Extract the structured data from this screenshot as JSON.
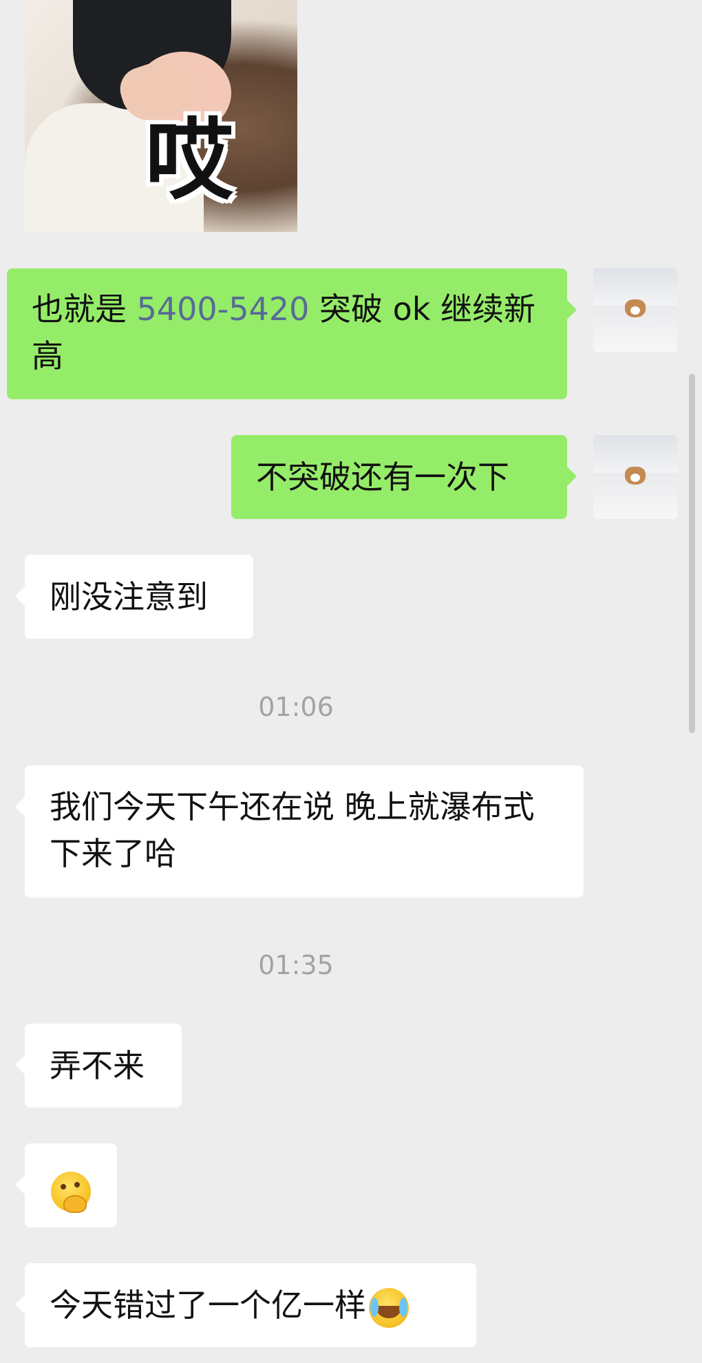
{
  "chat": {
    "sticker": {
      "caption": "哎",
      "icon": "sticker-image"
    },
    "messages": [
      {
        "sender": "me",
        "text_before": "也就是 ",
        "number": "5400-5420",
        "text_after": " 突破 ok 继续新高"
      },
      {
        "sender": "me",
        "text": "不突破还有一次下"
      },
      {
        "sender": "other",
        "text": "刚没注意到"
      },
      {
        "sender": "other",
        "text": "我们今天下午还在说 晚上就瀑布式下来了哈"
      },
      {
        "sender": "other",
        "text": "弄不来"
      },
      {
        "sender": "other",
        "emoji": "thinking-hand-over-mouth-emoji"
      },
      {
        "sender": "other",
        "text": "今天错过了一个亿一样",
        "emoji": "loudly-crying-emoji"
      }
    ],
    "timestamps": [
      "01:06",
      "01:35"
    ]
  },
  "colors": {
    "background": "#ededed",
    "my_bubble": "#95ec69",
    "other_bubble": "#ffffff",
    "link_number": "#576b95",
    "timestamp": "#a3a3a3"
  }
}
